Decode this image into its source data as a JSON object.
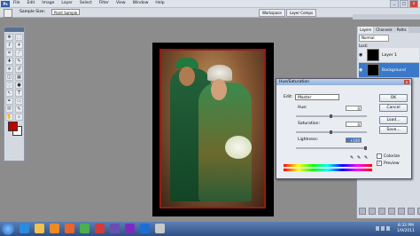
{
  "menubar": {
    "logo": "Ps",
    "items": [
      "File",
      "Edit",
      "Image",
      "Layer",
      "Select",
      "Filter",
      "View",
      "Window",
      "Help"
    ],
    "window_buttons": [
      "_",
      "□",
      "x"
    ]
  },
  "optionsbar": {
    "label": "Sample Size:",
    "select_value": "Point Sample",
    "workspace_buttons": [
      "Workspace",
      "Layer Comps"
    ]
  },
  "toolbox": {
    "tools": [
      "move-icon",
      "marquee-icon",
      "lasso-icon",
      "magic-wand-icon",
      "crop-icon",
      "slice-icon",
      "healing-icon",
      "brush-icon",
      "stamp-icon",
      "history-brush-icon",
      "eraser-icon",
      "gradient-icon",
      "blur-icon",
      "dodge-icon",
      "path-select-icon",
      "type-icon",
      "pen-icon",
      "shape-icon",
      "notes-icon",
      "eyedropper-icon",
      "hand-icon",
      "zoom-icon"
    ],
    "foreground_color": "#c00000",
    "background_color": "#ffffff"
  },
  "layers_panel": {
    "tabs": [
      "Layers",
      "Channels",
      "Paths"
    ],
    "blend_mode": "Normal",
    "lock_label": "Lock:",
    "layers": [
      {
        "name": "Layer 1",
        "selected": false
      },
      {
        "name": "Background",
        "selected": true
      }
    ]
  },
  "hue_saturation": {
    "title": "Hue/Saturation",
    "close": "x",
    "edit_label": "Edit:",
    "edit_value": "Master",
    "hue_label": "Hue:",
    "hue_value": "0",
    "saturation_label": "Saturation:",
    "saturation_value": "0",
    "lightness_label": "Lightness:",
    "lightness_value": "+100",
    "buttons": {
      "ok": "OK",
      "cancel": "Cancel",
      "load": "Load...",
      "save": "Save..."
    },
    "colorize_label": "Colorize",
    "colorize_checked": false,
    "preview_label": "Preview",
    "preview_checked": true
  },
  "taskbar": {
    "apps": [
      "ie-icon",
      "folder-icon",
      "media-player-icon",
      "firefox-icon",
      "chrome-icon",
      "opera-icon",
      "bridge-icon",
      "yahoo-icon",
      "photoshop-icon",
      "app-icon"
    ],
    "time": "8:33 PM",
    "date": "1/9/2011"
  },
  "colors": {
    "accent": "#3a78c9",
    "canvas_bg": "#8c8c8c"
  }
}
